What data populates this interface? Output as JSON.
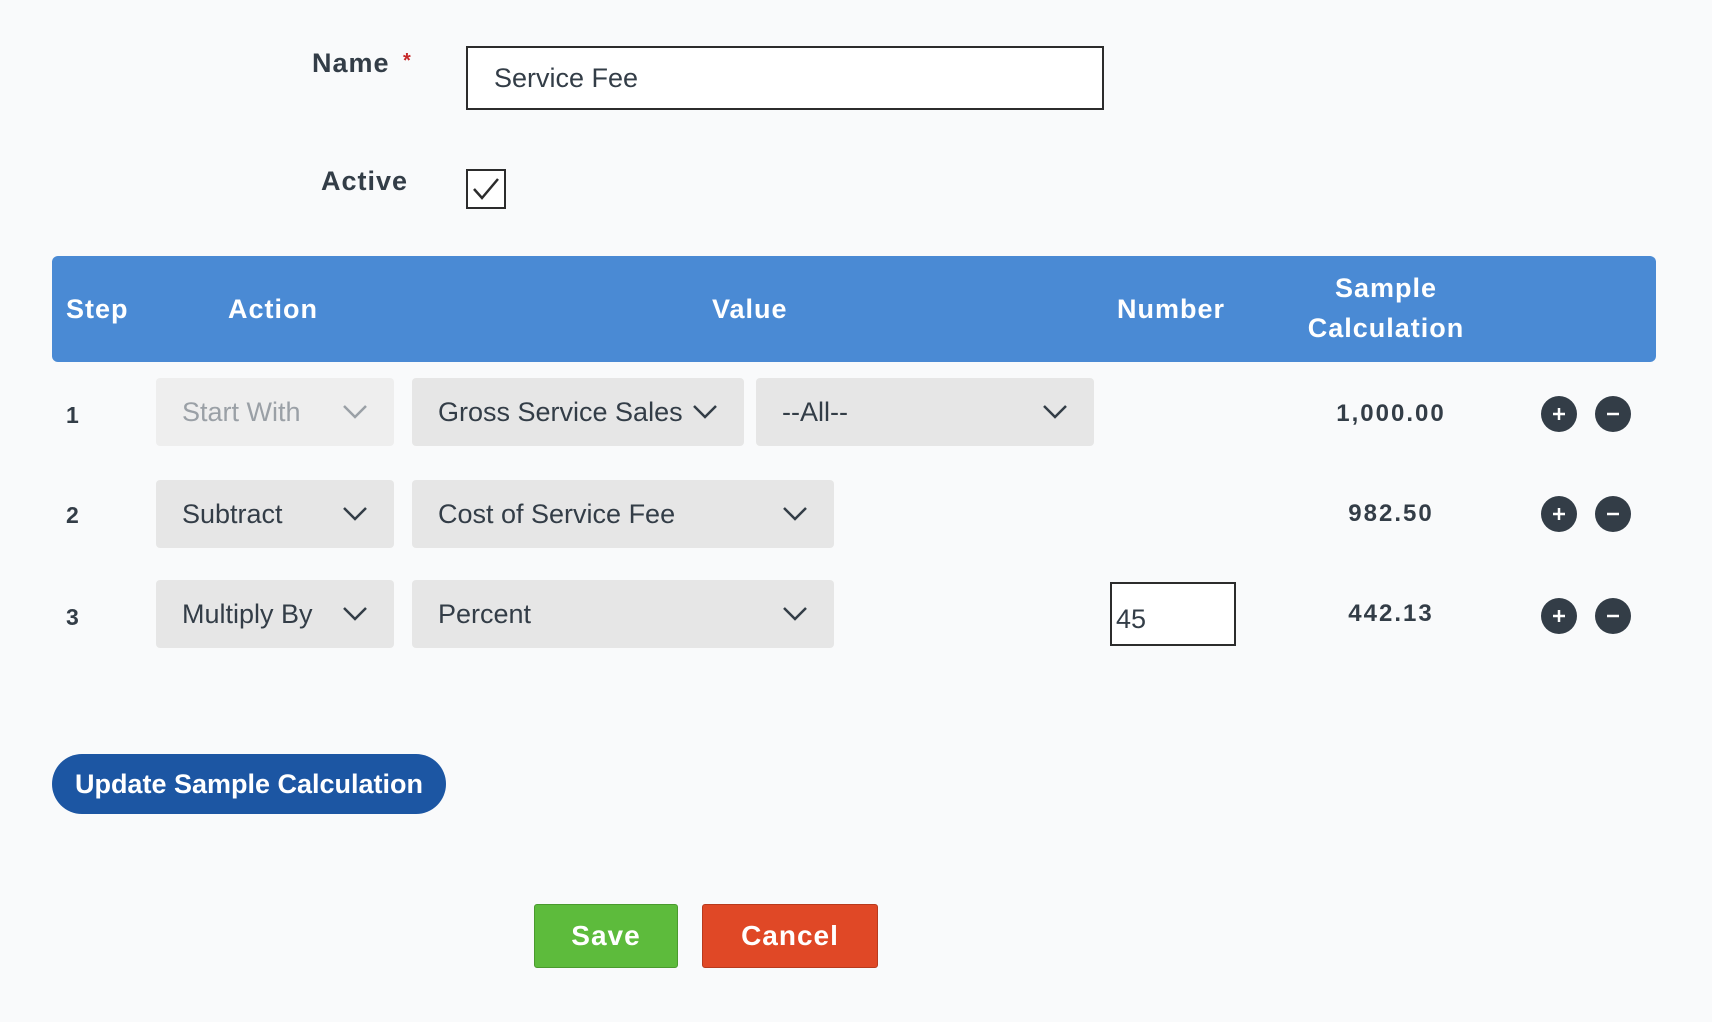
{
  "form": {
    "name_label": "Name",
    "required_marker": "*",
    "name_value": "Service Fee",
    "active_label": "Active",
    "active_checked": true
  },
  "table": {
    "headers": {
      "step": "Step",
      "action": "Action",
      "value": "Value",
      "number": "Number",
      "sample_line1": "Sample",
      "sample_line2": "Calculation"
    },
    "rows": [
      {
        "step": "1",
        "action": "Start With",
        "action_disabled": true,
        "value": "Gross Service Sales",
        "value2": "--All--",
        "number": "",
        "sample": "1,000.00"
      },
      {
        "step": "2",
        "action": "Subtract",
        "value": "Cost of Service Fee",
        "number": "",
        "sample": "982.50"
      },
      {
        "step": "3",
        "action": "Multiply By",
        "value": "Percent",
        "number": "45",
        "sample": "442.13"
      }
    ]
  },
  "buttons": {
    "update": "Update Sample Calculation",
    "save": "Save",
    "cancel": "Cancel"
  },
  "icons": {
    "checkmark": "check-icon",
    "chevron": "chevron-down-icon",
    "add": "plus-icon",
    "remove": "minus-icon"
  },
  "colors": {
    "header_bg": "#4a8ad4",
    "update_btn": "#1c56a3",
    "save_btn": "#5dbb3c",
    "cancel_btn": "#e04826",
    "round_btn": "#333d47"
  }
}
